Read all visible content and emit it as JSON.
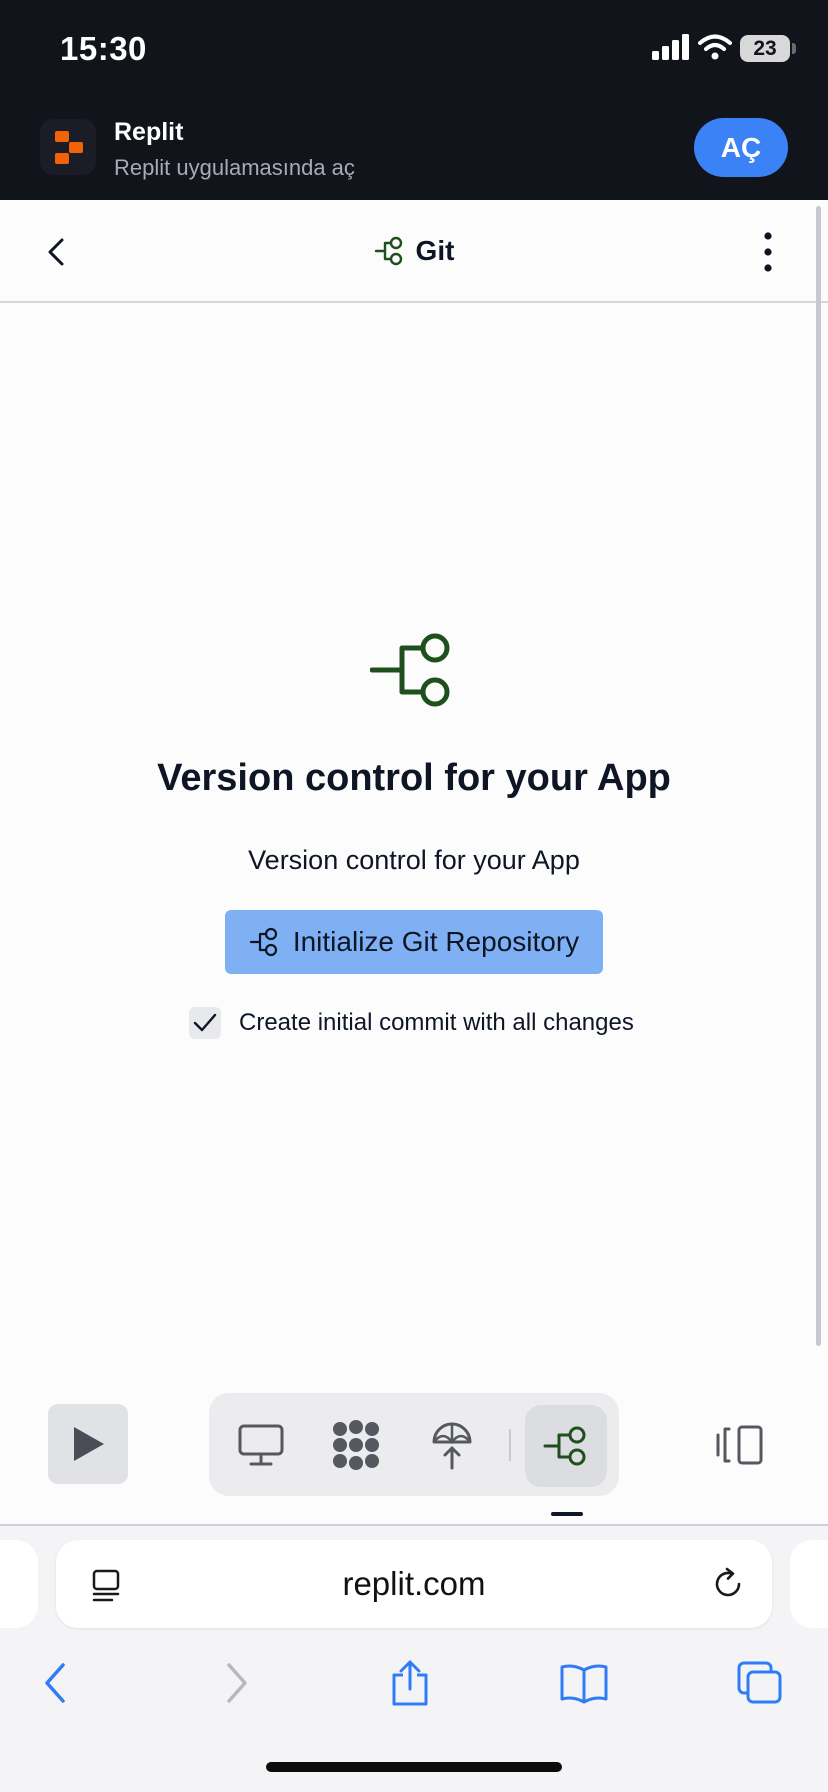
{
  "status_bar": {
    "time": "15:30",
    "battery": "23"
  },
  "app_banner": {
    "app_name": "Replit",
    "subtitle": "Replit uygulamasında aç",
    "open_label": "AÇ"
  },
  "header": {
    "title": "Git"
  },
  "empty_state": {
    "heading": "Version control for your App",
    "description": "Version control for your App",
    "button_label": "Initialize Git Repository",
    "checkbox_label": "Create initial commit with all changes",
    "checkbox_checked": true
  },
  "toolbar": {
    "tools": [
      "run-icon",
      "webview-icon",
      "packages-icon",
      "deploy-icon",
      "git-icon"
    ],
    "active_tool": "git-icon"
  },
  "browser": {
    "url": "replit.com"
  },
  "colors": {
    "banner_bg": "#12141b",
    "accent_blue": "#3b82f6",
    "primary_button": "#7fb0f4",
    "git_green": "#1f4f1c"
  }
}
